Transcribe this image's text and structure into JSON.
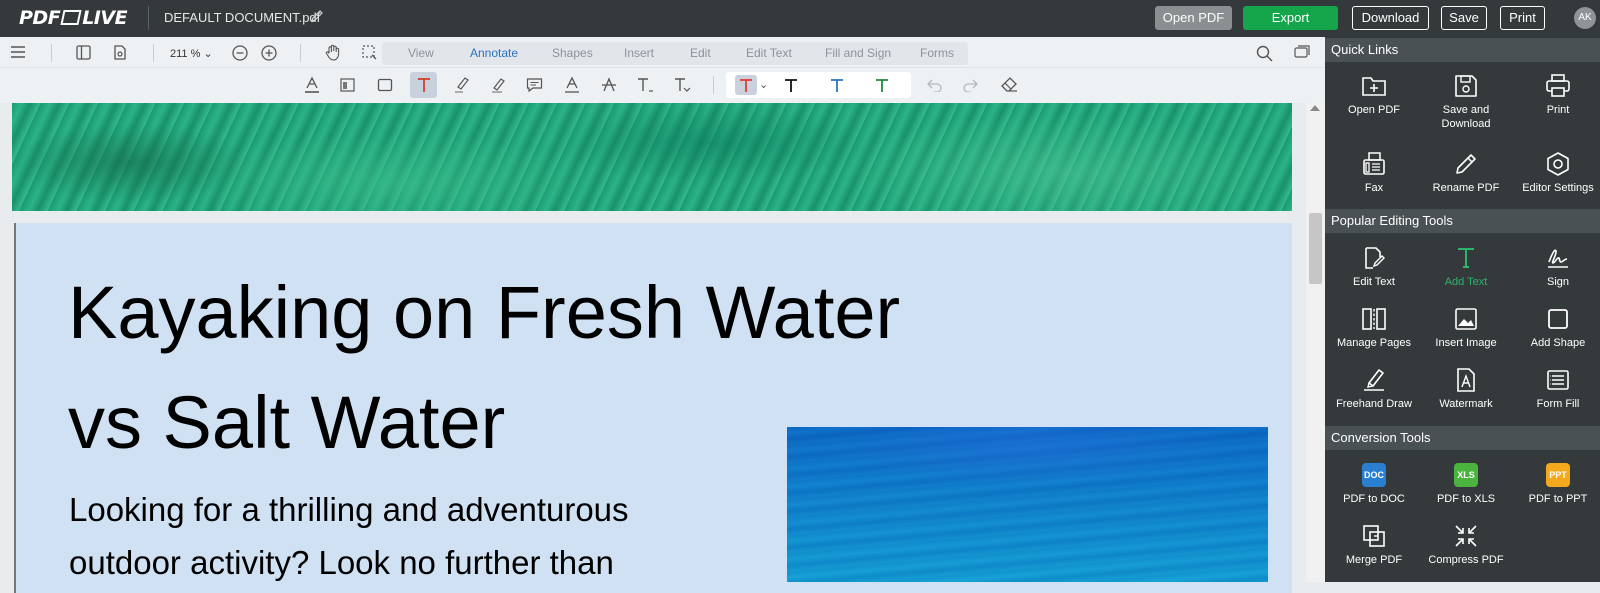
{
  "app": {
    "logo_left": "PDF",
    "logo_right": "LIVE",
    "document_name": "DEFAULT DOCUMENT.pdf"
  },
  "header_buttons": {
    "open_pdf": "Open PDF",
    "export": "Export",
    "download": "Download",
    "save": "Save",
    "print": "Print",
    "avatar": "AK"
  },
  "toolbar": {
    "zoom": "211 %"
  },
  "tabs": [
    "View",
    "Annotate",
    "Shapes",
    "Insert",
    "Edit",
    "Edit Text",
    "Fill and Sign",
    "Forms"
  ],
  "active_tab": "Annotate",
  "text_colors": [
    "#e53935",
    "#111111",
    "#2a74c2",
    "#1e8a3a"
  ],
  "document": {
    "title_line1": "Kayaking on Fresh Water",
    "title_line2": "vs Salt Water",
    "body_line1": "Looking for a thrilling and adventurous",
    "body_line2": "outdoor activity? Look no further than"
  },
  "panel": {
    "quick_links_title": "Quick Links",
    "quick_links": [
      "Open PDF",
      "Save and Download",
      "Print",
      "Fax",
      "Rename PDF",
      "Editor Settings"
    ],
    "popular_title": "Popular Editing Tools",
    "popular": [
      "Edit Text",
      "Add Text",
      "Sign",
      "Manage Pages",
      "Insert Image",
      "Add Shape",
      "Freehand Draw",
      "Watermark",
      "Form Fill"
    ],
    "active_tool": "Add Text",
    "conversion_title": "Conversion Tools",
    "conversion": [
      "PDF to DOC",
      "PDF to XLS",
      "PDF to PPT",
      "Merge PDF",
      "Compress PDF"
    ],
    "badges": {
      "doc": "DOC",
      "xls": "XLS",
      "ppt": "PPT"
    },
    "badge_colors": {
      "doc": "#2b7fd0",
      "xls": "#4bb43f",
      "ppt": "#f3a81d"
    }
  }
}
